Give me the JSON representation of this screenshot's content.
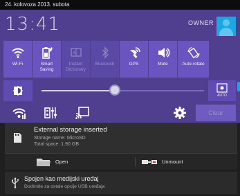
{
  "status_bar": {
    "date_text": "24. kolovoza 2013. subota"
  },
  "quick_settings": {
    "clock": "13:41",
    "owner_label": "OWNER",
    "toggles": [
      {
        "label": "Wi-Fi",
        "icon": "wifi-icon",
        "active": true
      },
      {
        "label": "Smart\nSaving",
        "icon": "smart-saving-icon",
        "active": true
      },
      {
        "label": "Instant\nDictionary",
        "icon": "dictionary-icon",
        "active": false
      },
      {
        "label": "Bluetooth",
        "icon": "bluetooth-icon",
        "active": false
      },
      {
        "label": "GPS",
        "icon": "gps-icon",
        "active": true
      },
      {
        "label": "Mute",
        "icon": "mute-icon",
        "active": true
      },
      {
        "label": "Auto-rotate",
        "icon": "auto-rotate-icon",
        "active": true
      }
    ],
    "brightness": {
      "level": 0.45,
      "auto_label": "AUTO"
    },
    "clear_label": "Clear"
  },
  "notifications": [
    {
      "title": "External storage inserted",
      "lines": [
        "Storage name: MicroSD",
        "Total space: 1.90 GB"
      ],
      "actions": [
        {
          "label": "Open",
          "icon": "folder-icon"
        },
        {
          "label": "Unmount",
          "icon": "unmount-icon"
        }
      ]
    },
    {
      "title": "Spojen kao medijski uređaj",
      "subtitle": "Dodirnite za ostale opcije USB uređaja"
    }
  ],
  "colors": {
    "panel": "#503f8e",
    "tile_active": "#6a55c0",
    "accent": "#1ba7e1",
    "notification_bg": "#2f2f2f"
  }
}
